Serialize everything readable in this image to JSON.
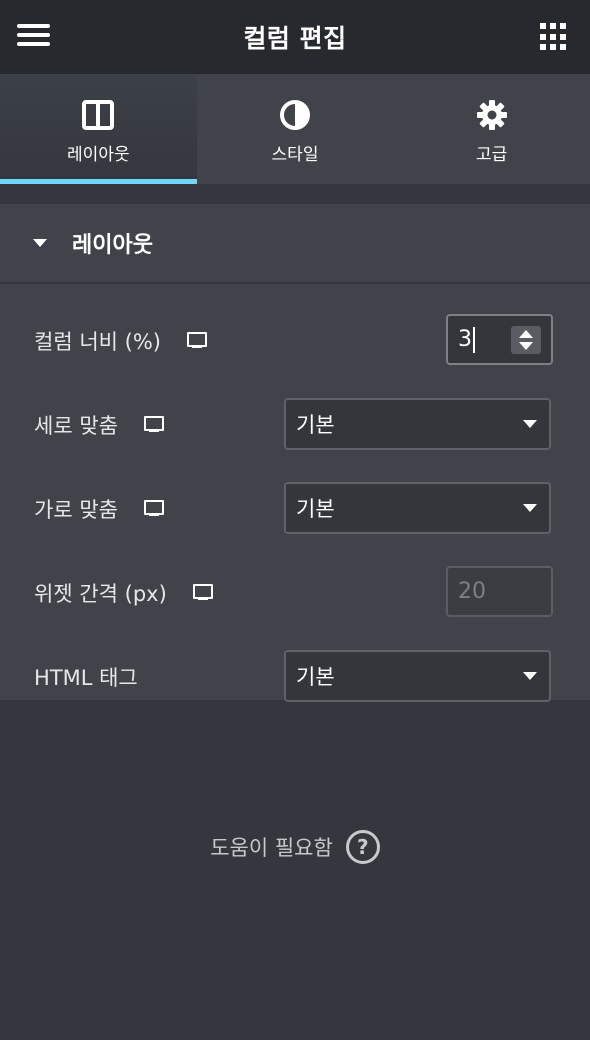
{
  "header": {
    "title": "컬럼 편집",
    "menu_icon": "hamburger-icon",
    "grid_icon": "apps-grid-icon"
  },
  "tabs": [
    {
      "label": "레이아웃",
      "icon": "columns-layout-icon",
      "active": true
    },
    {
      "label": "스타일",
      "icon": "half-circle-contrast-icon",
      "active": false
    },
    {
      "label": "고급",
      "icon": "gear-icon",
      "active": false
    }
  ],
  "accent_color": "#71d7f7",
  "section": {
    "title": "레이아웃"
  },
  "fields": {
    "column_width": {
      "label": "컬럼 너비 (%)",
      "value": "3"
    },
    "vertical_align": {
      "label": "세로 맞춤",
      "value": "기본"
    },
    "horizontal_align": {
      "label": "가로 맞춤",
      "value": "기본"
    },
    "widget_gap": {
      "label": "위젯 간격 (px)",
      "placeholder": "20"
    },
    "html_tag": {
      "label": "HTML 태그",
      "value": "기본"
    }
  },
  "help": {
    "text": "도움이 필요함",
    "icon": "question-circle-icon"
  }
}
